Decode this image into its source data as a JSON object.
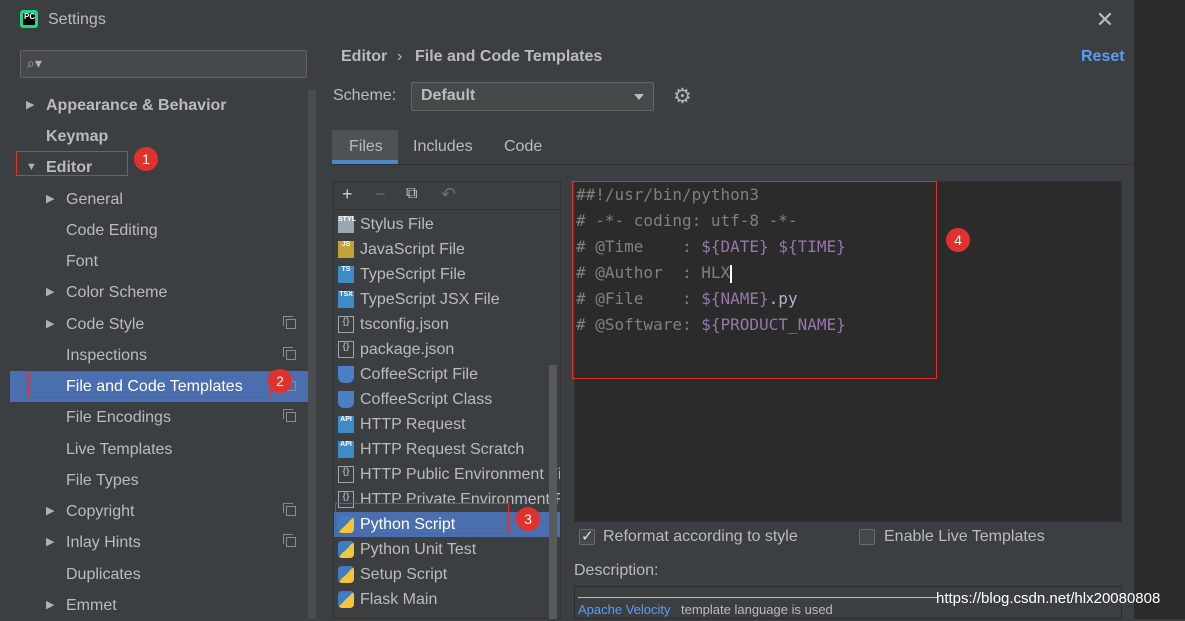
{
  "window": {
    "title": "Settings",
    "logo_text": "PC",
    "close_symbol": "✕"
  },
  "search": {
    "placeholder": "",
    "icon": "search-icon"
  },
  "nav": {
    "items": [
      {
        "label": "Appearance & Behavior",
        "arrow": "▶"
      },
      {
        "label": "Keymap",
        "arrow": ""
      },
      {
        "label": "Editor",
        "arrow": "▼"
      },
      {
        "label": "General",
        "arrow": "▶"
      },
      {
        "label": "Code Editing",
        "arrow": ""
      },
      {
        "label": "Font",
        "arrow": ""
      },
      {
        "label": "Color Scheme",
        "arrow": "▶"
      },
      {
        "label": "Code Style",
        "arrow": "▶"
      },
      {
        "label": "Inspections",
        "arrow": ""
      },
      {
        "label": "File and Code Templates",
        "arrow": ""
      },
      {
        "label": "File Encodings",
        "arrow": ""
      },
      {
        "label": "Live Templates",
        "arrow": ""
      },
      {
        "label": "File Types",
        "arrow": ""
      },
      {
        "label": "Copyright",
        "arrow": "▶"
      },
      {
        "label": "Inlay Hints",
        "arrow": "▶"
      },
      {
        "label": "Duplicates",
        "arrow": ""
      },
      {
        "label": "Emmet",
        "arrow": "▶"
      }
    ]
  },
  "breadcrumb": {
    "parent": "Editor",
    "separator": "›",
    "current": "File and Code Templates"
  },
  "reset_label": "Reset",
  "scheme": {
    "label": "Scheme:",
    "value": "Default"
  },
  "tabs": [
    {
      "label": "Files"
    },
    {
      "label": "Includes"
    },
    {
      "label": "Code"
    }
  ],
  "toolbar": {
    "add": "+",
    "remove": "−",
    "copy": "⧉",
    "undo": "↶"
  },
  "files": [
    {
      "label": "Stylus File",
      "icon": "STYL"
    },
    {
      "label": "JavaScript File",
      "icon": "JS"
    },
    {
      "label": "TypeScript File",
      "icon": "TS"
    },
    {
      "label": "TypeScript JSX File",
      "icon": "TSX"
    },
    {
      "label": "tsconfig.json",
      "icon": "{}"
    },
    {
      "label": "package.json",
      "icon": "{}"
    },
    {
      "label": "CoffeeScript File",
      "icon": ""
    },
    {
      "label": "CoffeeScript Class",
      "icon": ""
    },
    {
      "label": "HTTP Request",
      "icon": "API"
    },
    {
      "label": "HTTP Request Scratch",
      "icon": "API"
    },
    {
      "label": "HTTP Public Environment Fi",
      "icon": "{}"
    },
    {
      "label": "HTTP Private Environment F",
      "icon": "{}"
    },
    {
      "label": "Python Script",
      "icon": ""
    },
    {
      "label": "Python Unit Test",
      "icon": ""
    },
    {
      "label": "Setup Script",
      "icon": ""
    },
    {
      "label": "Flask Main",
      "icon": ""
    }
  ],
  "editor": {
    "lines": [
      {
        "a": "##!/usr/bin/python3",
        "b": "",
        "c": "",
        "d": "",
        "e": ""
      },
      {
        "a": "# -*- coding: utf-8 -*-",
        "b": "",
        "c": "",
        "d": "",
        "e": ""
      },
      {
        "a": "# @Time    : ",
        "b": "${DATE}",
        "c": " ",
        "d": "${TIME}",
        "e": ""
      },
      {
        "a": "# @Author  : HLX",
        "b": "",
        "c": "",
        "d": "",
        "e": ""
      },
      {
        "a": "# @File    : ",
        "b": "${NAME}",
        "c": ".py",
        "d": "",
        "e": ""
      },
      {
        "a": "# @Software: ",
        "b": "${PRODUCT_NAME}",
        "c": "",
        "d": "",
        "e": ""
      }
    ]
  },
  "options": {
    "reformat_label": "Reformat according to style",
    "reformat_checked": true,
    "live_label": "Enable Live Templates",
    "live_checked": false
  },
  "description": {
    "label": "Description:",
    "link": "Apache Velocity",
    "text": "template language is used"
  },
  "annotations": [
    "1",
    "2",
    "3",
    "4"
  ],
  "watermark": "https://blog.csdn.net/hlx20080808",
  "colors": {
    "accent": "#4b6eaf",
    "link": "#589df6",
    "annotation": "#e0312d",
    "template_var": "#9876aa"
  }
}
